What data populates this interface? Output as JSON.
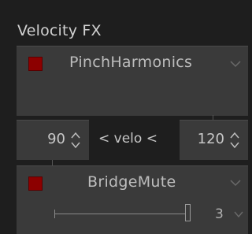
{
  "panel": {
    "title": "Velocity FX"
  },
  "fx1": {
    "name": "PinchHarmonics",
    "enabled": true,
    "led_color": "#8c0000"
  },
  "velo": {
    "min": "90",
    "label": "< velo <",
    "max": "120"
  },
  "fx2": {
    "name": "BridgeMute",
    "enabled": true,
    "led_color": "#8c0000",
    "slider_value": "3",
    "slider_level": 0.98
  },
  "icons": {
    "dropdown": "chevron-down-icon",
    "spin": "up-down-arrows-icon"
  }
}
